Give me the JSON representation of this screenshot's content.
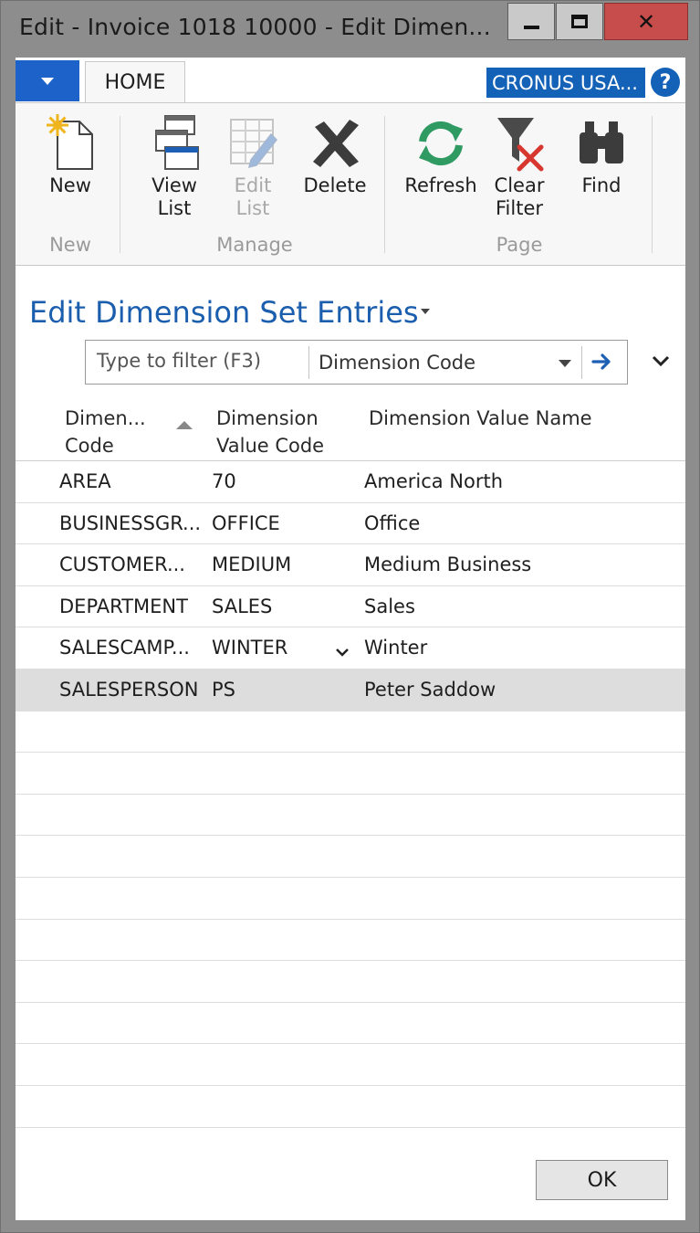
{
  "window": {
    "title": "Edit - Invoice 1018 10000 - Edit Dimen...",
    "controls": {
      "minimize": "minimize",
      "maximize": "maximize",
      "close": "close"
    }
  },
  "ribbon": {
    "tab": "HOME",
    "company": "CRONUS USA...",
    "help": "?",
    "buttons": {
      "new": "New",
      "view_list_1": "View",
      "view_list_2": "List",
      "edit_list_1": "Edit",
      "edit_list_2": "List",
      "delete": "Delete",
      "refresh": "Refresh",
      "clear_filter_1": "Clear",
      "clear_filter_2": "Filter",
      "find": "Find"
    },
    "groups": {
      "new": "New",
      "manage": "Manage",
      "page": "Page"
    }
  },
  "page": {
    "title": "Edit Dimension Set Entries"
  },
  "filter": {
    "placeholder": "Type to filter (F3)",
    "field": "Dimension Code"
  },
  "grid": {
    "headers": {
      "col1_line1": "Dimen...",
      "col1_line2": "Code",
      "col2_line1": "Dimension",
      "col2_line2": "Value Code",
      "col3": "Dimension Value Name"
    },
    "rows": [
      {
        "code": "AREA",
        "value_code": "70",
        "value_name": "America North"
      },
      {
        "code": "BUSINESSGR...",
        "value_code": "OFFICE",
        "value_name": "Office"
      },
      {
        "code": "CUSTOMER...",
        "value_code": "MEDIUM",
        "value_name": "Medium Business"
      },
      {
        "code": "DEPARTMENT",
        "value_code": "SALES",
        "value_name": "Sales"
      },
      {
        "code": "SALESCAMP...",
        "value_code": "WINTER",
        "value_name": "Winter"
      },
      {
        "code": "SALESPERSON",
        "value_code": "PS",
        "value_name": "Peter Saddow"
      }
    ],
    "selected_row": 5
  },
  "footer": {
    "ok": "OK"
  },
  "colors": {
    "accent": "#1c62c8",
    "title_blue": "#1a5ead",
    "close_red": "#c64d4b"
  }
}
